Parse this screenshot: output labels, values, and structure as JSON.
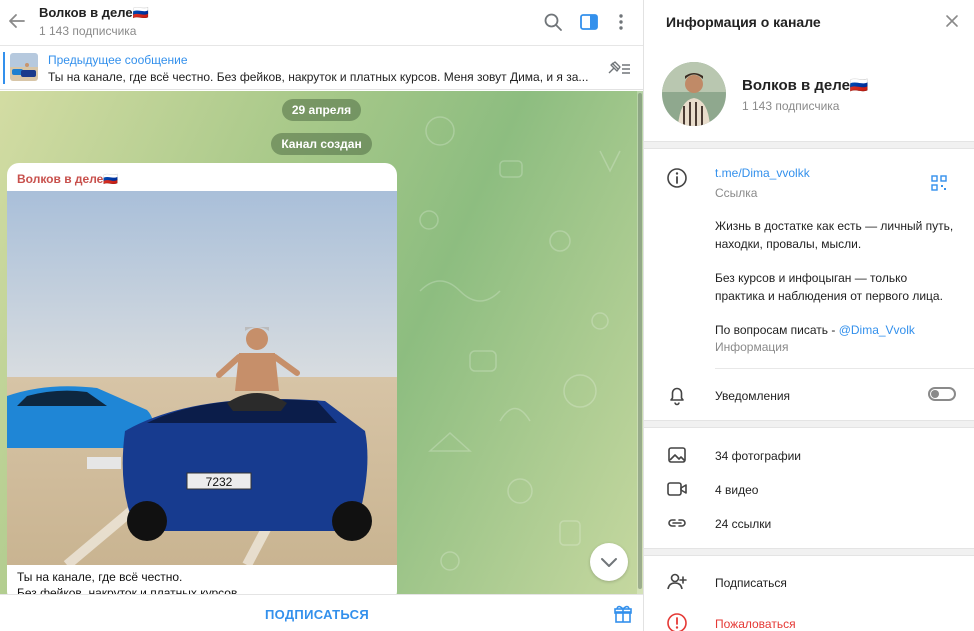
{
  "chat": {
    "title": "Волков в деле🇷🇺",
    "subtitle": "1 143 подписчика",
    "pinned": {
      "title": "Предыдущее сообщение",
      "text": "Ты на канале, где всё честно. Без фейков, накруток и платных курсов.  Меня зовут Дима, и я за..."
    },
    "date_service": "29 апреля",
    "created_service": "Канал создан",
    "post": {
      "author": "Волков в деле🇷🇺",
      "line1": "Ты на канале, где всё честно.",
      "line2": "Без фейков, накруток и платных курсов",
      "photo_plates": [
        "7232",
        "7232"
      ]
    },
    "subscribe_label": "ПОДПИСАТЬСЯ"
  },
  "info": {
    "header": "Информация о канале",
    "name": "Волков в деле🇷🇺",
    "subscribers": "1 143 подписчика",
    "link": "t.me/Dima_vvolkk",
    "link_caption": "Ссылка",
    "desc_line1": "Жизнь в достатке как есть — личный путь,",
    "desc_line2": "находки, провалы, мысли.",
    "desc_line3": "Без курсов и инфоцыган — только",
    "desc_line4": "практика и наблюдения от первого лица.",
    "desc_line5_prefix": "По вопросам писать - ",
    "desc_line5_mention": "@Dima_Vvolk",
    "desc_caption": "Информация",
    "notifications_label": "Уведомления",
    "notifications_on": false,
    "media": {
      "photos": "34 фотографии",
      "videos": "4 видео",
      "links": "24 ссылки"
    },
    "subscribe_action": "Подписаться",
    "report_action": "Пожаловаться"
  },
  "colors": {
    "accent": "#3390ec",
    "author": "#c8514d",
    "danger": "#e53935"
  }
}
